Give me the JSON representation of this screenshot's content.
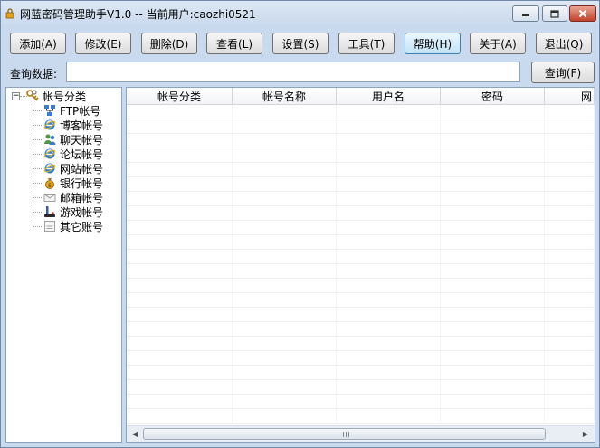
{
  "window": {
    "title": "网蓝密码管理助手V1.0 -- 当前用户:caozhi0521"
  },
  "toolbar": {
    "buttons": [
      {
        "label": "添加(A)"
      },
      {
        "label": "修改(E)"
      },
      {
        "label": "删除(D)"
      },
      {
        "label": "查看(L)"
      },
      {
        "label": "设置(S)"
      },
      {
        "label": "工具(T)"
      },
      {
        "label": "帮助(H)"
      },
      {
        "label": "关于(A)"
      },
      {
        "label": "退出(Q)"
      }
    ]
  },
  "search": {
    "label": "查询数据:",
    "value": "",
    "button_label": "查询(F)"
  },
  "tree": {
    "root_label": "帐号分类",
    "items": [
      {
        "label": "FTP帐号",
        "icon": "ftp-network-icon"
      },
      {
        "label": "博客帐号",
        "icon": "ie-globe-icon"
      },
      {
        "label": "聊天帐号",
        "icon": "chat-users-icon"
      },
      {
        "label": "论坛帐号",
        "icon": "ie-globe-icon"
      },
      {
        "label": "网站帐号",
        "icon": "ie-globe-icon"
      },
      {
        "label": "银行帐号",
        "icon": "money-bag-icon"
      },
      {
        "label": "邮箱帐号",
        "icon": "mail-envelope-icon"
      },
      {
        "label": "游戏帐号",
        "icon": "joystick-icon"
      },
      {
        "label": "其它账号",
        "icon": "document-list-icon"
      }
    ]
  },
  "grid": {
    "columns": [
      "帐号分类",
      "帐号名称",
      "用户名",
      "密码",
      "网"
    ]
  },
  "colors": {
    "window_bg": "#c9d9ee",
    "close_button": "#c3422a",
    "active_button": "#c3e2f6"
  }
}
